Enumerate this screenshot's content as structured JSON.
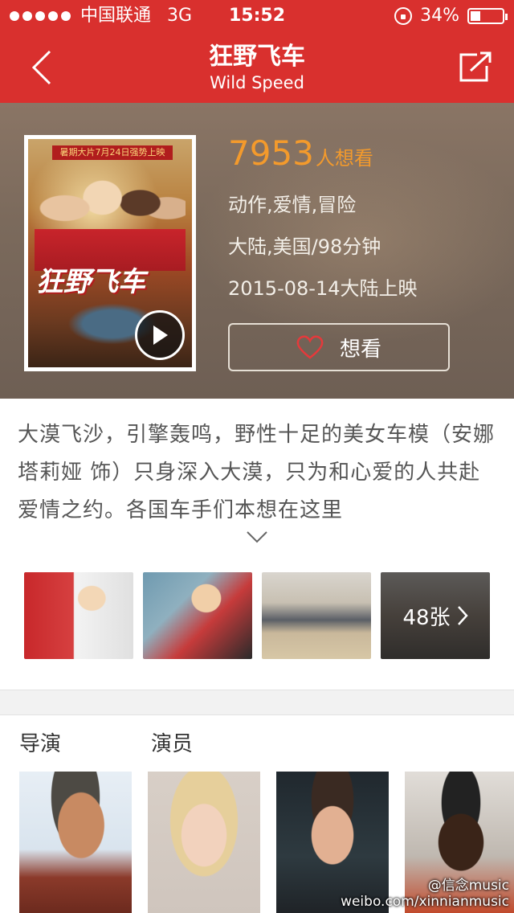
{
  "status_bar": {
    "carrier": "中国联通",
    "network": "3G",
    "time": "15:52",
    "battery": "34%"
  },
  "nav": {
    "title": "狂野飞车",
    "subtitle": "Wild Speed"
  },
  "movie": {
    "want_count": "7953",
    "want_unit": "人想看",
    "genres": "动作,爱情,冒险",
    "region_duration": "大陆,美国/98分钟",
    "release": "2015-08-14大陆上映",
    "want_button_label": "想看",
    "poster_logo": "狂野飞车",
    "poster_banner": "暑期大片7月24日强势上映"
  },
  "synopsis": {
    "text": "大漠飞沙，引擎轰鸣，野性十足的美女车模（安娜塔莉娅 饰）只身深入大漠，只为和心爱的人共赴爱情之约。各国车手们本想在这里"
  },
  "stills": {
    "count_label": "48张"
  },
  "credits": {
    "director_label": "导演",
    "cast_label": "演员"
  },
  "watermark": {
    "handle": "@信念music",
    "url": "weibo.com/xinnianmusic"
  },
  "colors": {
    "brand_red": "#d9302e",
    "want_orange": "#f39a2c"
  }
}
